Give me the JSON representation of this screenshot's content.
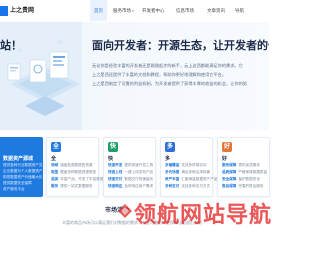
{
  "nav": {
    "logo_text": "上之贵网",
    "items": [
      {
        "label": "首页",
        "active": true
      },
      {
        "label": "服务市场",
        "has_caret": true
      },
      {
        "label": "开发者中心"
      },
      {
        "label": "信息市场"
      },
      {
        "label": "文章资讯"
      },
      {
        "label": "导航"
      }
    ]
  },
  "hero": {
    "left_title": "站！",
    "title": "面向开发者：开源生态，让开发者的付出",
    "lines": [
      "无论你是经验丰富的开发者还是刚刚起步的新手，云上这西都能满足你的需求。它",
      "上之是西还提供了丰富的文档和教程，帮助你更好地理解和使用它平台。",
      "上之是西制定了可靠的利益机制，为开发者提供了获得丰厚的收益的机会，让你的努"
    ]
  },
  "cards": [
    {
      "icon": "",
      "title": "数据资产源城",
      "lines": [
        {
          "tag": "",
          "text": "提供各种行业数据资产交易"
        },
        {
          "tag": "",
          "text": "企业数据与个人数据资产交易"
        },
        {
          "tag": "",
          "text": "助您数据资产价值最大化"
        },
        {
          "tag": "",
          "text": "提供数据安全保障"
        },
        {
          "tag": "",
          "text": "资产服务平台"
        }
      ]
    },
    {
      "icon": "全",
      "title": "全",
      "lines": [
        {
          "tag": "领域",
          "text": "涵盖各类数据的资源"
        },
        {
          "tag": "类型",
          "text": "覆盖多种数据资源类型"
        },
        {
          "tag": "品类",
          "text": "丰富产品，开发了丰富类型"
        },
        {
          "tag": "服务",
          "text": "提供一站式数据服务"
        }
      ]
    },
    {
      "icon": "快",
      "title": "快",
      "lines": [
        {
          "tag": "快速开发",
          "text": "提供快速开发工具"
        },
        {
          "tag": "快速上线",
          "text": "一键上线发布产品"
        },
        {
          "tag": "快速交付",
          "text": "数据交付快速高效"
        },
        {
          "tag": "快速响应",
          "text": "及时响应用户需求"
        }
      ]
    },
    {
      "icon": "多",
      "title": "多",
      "lines": [
        {
          "tag": "多端覆盖",
          "text": "支持多终端访问"
        },
        {
          "tag": "多元场景",
          "text": "满足多种应用场景"
        },
        {
          "tag": "资产丰富",
          "text": "汇聚海量数据资产产品"
        },
        {
          "tag": "多种支付",
          "text": "支持多种支付方式"
        }
      ]
    },
    {
      "icon": "好",
      "title": "好",
      "lines": [
        {
          "tag": "服务保障",
          "text": "提供优质服务"
        },
        {
          "tag": "品质保障",
          "text": "严格审核数据质量"
        },
        {
          "tag": "安全保障",
          "text": "保护数据安全"
        },
        {
          "tag": "售后保障",
          "text": "完善的售后服务"
        }
      ]
    }
  ],
  "section": {
    "title": "市场活动",
    "subtitle": "丰富的商品市场可以满足我们对数据的需求，安全可靠的平台保障让您放心交易"
  },
  "watermark": {
    "text": "领航网站导航"
  },
  "colors": {
    "brand": "#1f7ae0",
    "watermark": "#e62828"
  }
}
